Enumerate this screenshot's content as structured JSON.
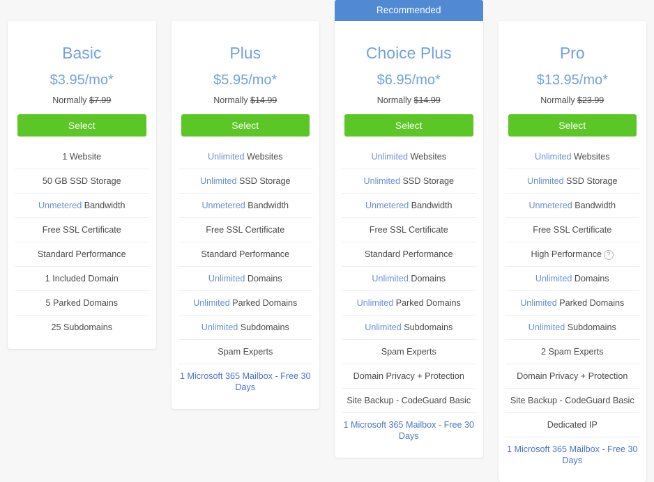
{
  "page": {
    "background_color": "#f7f7f7",
    "accent_blue": "#72a2dc",
    "banner_blue": "#5189d3",
    "button_green": "#5cc626",
    "link_blue": "#4b73c8",
    "highlight_blue": "#6b8ed6"
  },
  "labels": {
    "recommended": "Recommended",
    "select": "Select",
    "normally_prefix": "Normally",
    "info_icon": "?"
  },
  "plans": [
    {
      "id": "basic",
      "name": "Basic",
      "price": "$3.95/mo*",
      "normally_prefix": "Normally",
      "normally_price": "$7.99",
      "select_label": "Select",
      "recommended": false,
      "features": [
        {
          "highlight": "",
          "text": "1 Website",
          "link": false
        },
        {
          "highlight": "",
          "text": "50 GB SSD Storage",
          "link": false
        },
        {
          "highlight": "Unmetered",
          "text": " Bandwidth",
          "link": false
        },
        {
          "highlight": "",
          "text": "Free SSL Certificate",
          "link": false
        },
        {
          "highlight": "",
          "text": "Standard Performance",
          "link": false
        },
        {
          "highlight": "",
          "text": "1 Included Domain",
          "link": false
        },
        {
          "highlight": "",
          "text": "5 Parked Domains",
          "link": false
        },
        {
          "highlight": "",
          "text": "25 Subdomains",
          "link": false
        }
      ]
    },
    {
      "id": "plus",
      "name": "Plus",
      "price": "$5.95/mo*",
      "normally_prefix": "Normally",
      "normally_price": "$14.99",
      "select_label": "Select",
      "recommended": false,
      "features": [
        {
          "highlight": "Unlimited",
          "text": " Websites",
          "link": false
        },
        {
          "highlight": "Unlimited",
          "text": " SSD Storage",
          "link": false
        },
        {
          "highlight": "Unmetered",
          "text": " Bandwidth",
          "link": false
        },
        {
          "highlight": "",
          "text": "Free SSL Certificate",
          "link": false
        },
        {
          "highlight": "",
          "text": "Standard Performance",
          "link": false
        },
        {
          "highlight": "Unlimited",
          "text": " Domains",
          "link": false
        },
        {
          "highlight": "Unlimited",
          "text": " Parked Domains",
          "link": false
        },
        {
          "highlight": "Unlimited",
          "text": " Subdomains",
          "link": false
        },
        {
          "highlight": "",
          "text": "Spam Experts",
          "link": false
        },
        {
          "highlight": "",
          "text": "1 Microsoft 365 Mailbox - Free 30 Days",
          "link": true
        }
      ]
    },
    {
      "id": "choice-plus",
      "name": "Choice Plus",
      "price": "$6.95/mo*",
      "normally_prefix": "Normally",
      "normally_price": "$14.99",
      "select_label": "Select",
      "recommended": true,
      "banner_label": "Recommended",
      "features": [
        {
          "highlight": "Unlimited",
          "text": " Websites",
          "link": false
        },
        {
          "highlight": "Unlimited",
          "text": " SSD Storage",
          "link": false
        },
        {
          "highlight": "Unmetered",
          "text": " Bandwidth",
          "link": false
        },
        {
          "highlight": "",
          "text": "Free SSL Certificate",
          "link": false
        },
        {
          "highlight": "",
          "text": "Standard Performance",
          "link": false
        },
        {
          "highlight": "Unlimited",
          "text": " Domains",
          "link": false
        },
        {
          "highlight": "Unlimited",
          "text": " Parked Domains",
          "link": false
        },
        {
          "highlight": "Unlimited",
          "text": " Subdomains",
          "link": false
        },
        {
          "highlight": "",
          "text": "Spam Experts",
          "link": false
        },
        {
          "highlight": "",
          "text": "Domain Privacy + Protection",
          "link": false
        },
        {
          "highlight": "",
          "text": "Site Backup - CodeGuard Basic",
          "link": false
        },
        {
          "highlight": "",
          "text": "1 Microsoft 365 Mailbox - Free 30 Days",
          "link": true
        }
      ]
    },
    {
      "id": "pro",
      "name": "Pro",
      "price": "$13.95/mo*",
      "normally_prefix": "Normally",
      "normally_price": "$23.99",
      "select_label": "Select",
      "recommended": false,
      "features": [
        {
          "highlight": "Unlimited",
          "text": " Websites",
          "link": false
        },
        {
          "highlight": "Unlimited",
          "text": " SSD Storage",
          "link": false
        },
        {
          "highlight": "Unmetered",
          "text": " Bandwidth",
          "link": false
        },
        {
          "highlight": "",
          "text": "Free SSL Certificate",
          "link": false
        },
        {
          "highlight": "",
          "text": "High Performance",
          "link": false,
          "info": true
        },
        {
          "highlight": "Unlimited",
          "text": " Domains",
          "link": false
        },
        {
          "highlight": "Unlimited",
          "text": " Parked Domains",
          "link": false
        },
        {
          "highlight": "Unlimited",
          "text": " Subdomains",
          "link": false
        },
        {
          "highlight": "",
          "text": "2 Spam Experts",
          "link": false
        },
        {
          "highlight": "",
          "text": "Domain Privacy + Protection",
          "link": false
        },
        {
          "highlight": "",
          "text": "Site Backup - CodeGuard Basic",
          "link": false
        },
        {
          "highlight": "",
          "text": "Dedicated IP",
          "link": false
        },
        {
          "highlight": "",
          "text": "1 Microsoft 365 Mailbox - Free 30 Days",
          "link": true
        }
      ]
    }
  ]
}
